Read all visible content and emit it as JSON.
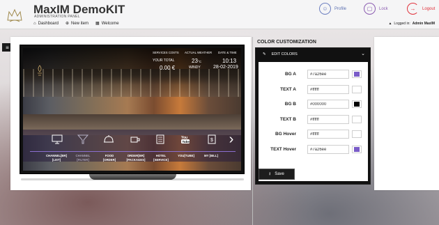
{
  "header": {
    "app_title": "MaxIM DemoKIT",
    "app_subtitle": "ADMINISTRATION PANEL",
    "nav": [
      {
        "label": "Dashboard",
        "icon": "home-icon"
      },
      {
        "label": "New item",
        "icon": "plus-circle-icon"
      },
      {
        "label": "Welcome",
        "icon": "grid-icon"
      }
    ],
    "profile_label": "Profile",
    "lock_label": "Lock",
    "logout_label": "Logout",
    "logged_prefix": "Logged in:",
    "logged_user": "Admin MaxIM"
  },
  "tv": {
    "services_costs_label": "SERVICES COSTS",
    "your_total_label": "YOUR TOTAL",
    "total_value": "0.00 €",
    "weather_label": "ACTUAL WEATHER",
    "temperature": "23",
    "temperature_unit": "°C",
    "weather_desc": "WINDY",
    "datetime_label": "DATE & TIME",
    "time": "10:13",
    "date": "28-02-2019",
    "menu": [
      {
        "label1": "CHANNEL[BR]",
        "label2": "[LIST]",
        "icon": "monitor-icon",
        "dim": false
      },
      {
        "label1": "CHANNEL",
        "label2": "[FILTER]",
        "icon": "filter-icon",
        "dim": true
      },
      {
        "label1": "FOOD",
        "label2": "[ORDER]",
        "icon": "cloche-icon",
        "dim": false
      },
      {
        "label1": "ORDER[BR]",
        "label2": "[PACKAGES]",
        "icon": "coffee-cup-icon",
        "dim": false
      },
      {
        "label1": "HOTEL",
        "label2": "[SERVICE]",
        "icon": "hotel-service-icon",
        "dim": false
      },
      {
        "label1": "YOU[TUBE]",
        "label2": "",
        "icon": "youtube-icon",
        "dim": false
      },
      {
        "label1": "MY [BILL]",
        "label2": "",
        "icon": "bill-icon",
        "dim": false
      }
    ]
  },
  "color_customization": {
    "title": "COLOR CUSTOMIZATION",
    "section_label": "EDIT COLORS",
    "fields": [
      {
        "label": "BG A",
        "value": "#7a26ee",
        "swatch": "#7a5cc8"
      },
      {
        "label": "TEXT A",
        "value": "#ffffff",
        "swatch": "#ffffff"
      },
      {
        "label": "BG B",
        "value": "#000000",
        "swatch": "#000000"
      },
      {
        "label": "TEXT B",
        "value": "#ffffff",
        "swatch": "#ffffff"
      },
      {
        "label": "BG Hover",
        "value": "#ffffff",
        "swatch": "#ffffff"
      },
      {
        "label": "TEXT Hover",
        "value": "#7a26ee",
        "swatch": "#7a5cc8"
      }
    ],
    "save_label": "Save"
  },
  "colors": {
    "accent_purple": "#8b6fd0",
    "logout_red": "#e0303a",
    "profile_blue": "#6d7fc0"
  }
}
